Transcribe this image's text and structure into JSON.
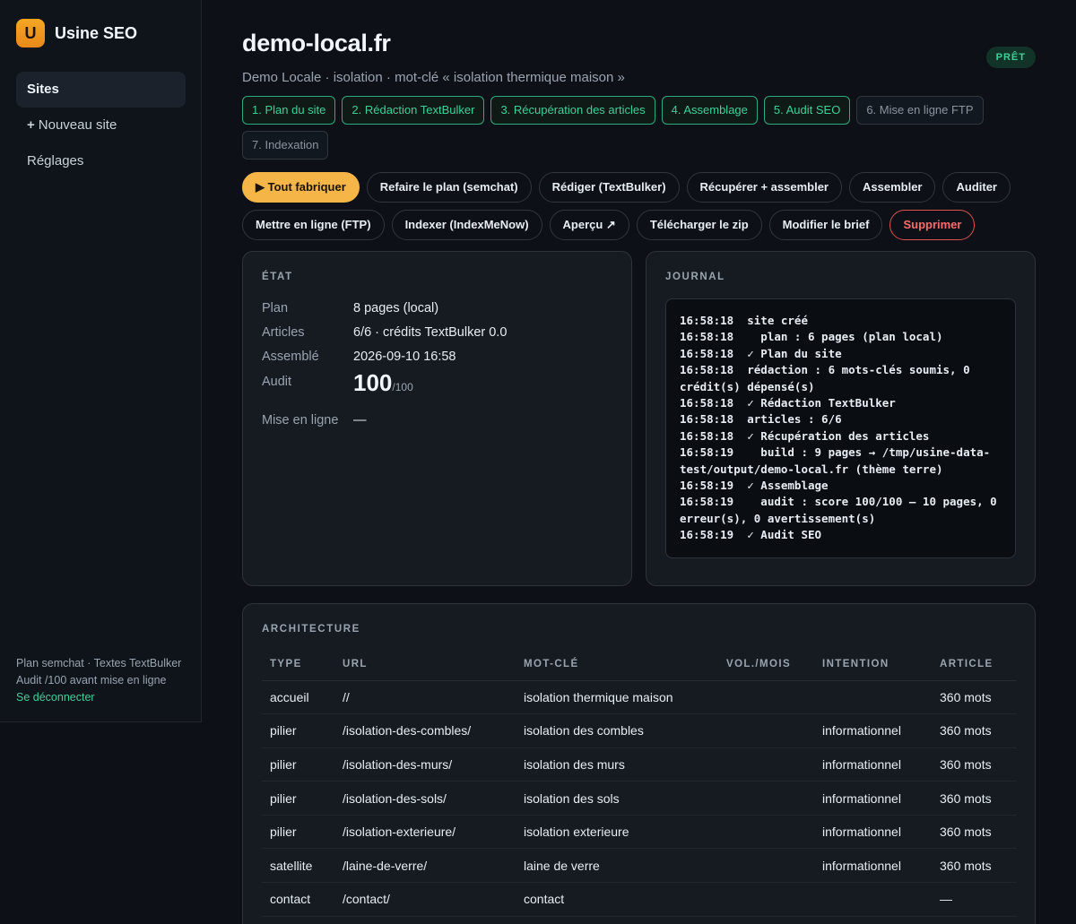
{
  "brand": {
    "logo_letter": "U",
    "name": "Usine SEO"
  },
  "sidebar": {
    "items": [
      {
        "label": "Sites"
      },
      {
        "icon": "+",
        "label": "Nouveau site"
      },
      {
        "label": "Réglages"
      }
    ],
    "footer": {
      "line1": "Plan semchat · Textes TextBulker",
      "line2": "Audit /100 avant mise en ligne",
      "logout": "Se déconnecter"
    }
  },
  "site": {
    "title": "demo-local.fr",
    "status": "PRÊT",
    "subtitle": "Demo Locale · isolation · mot-clé « isolation thermique maison »"
  },
  "steps": [
    {
      "label": "1. Plan du site",
      "done": true
    },
    {
      "label": "2. Rédaction TextBulker",
      "done": true
    },
    {
      "label": "3. Récupération des articles",
      "done": true
    },
    {
      "label": "4. Assemblage",
      "done": true
    },
    {
      "label": "5. Audit SEO",
      "done": true
    },
    {
      "label": "6. Mise en ligne FTP",
      "done": false
    },
    {
      "label": "7. Indexation",
      "done": false
    }
  ],
  "actions": [
    {
      "label": "▶ Tout fabriquer",
      "kind": "primary"
    },
    {
      "label": "Refaire le plan (semchat)",
      "kind": "default"
    },
    {
      "label": "Rédiger (TextBulker)",
      "kind": "default"
    },
    {
      "label": "Récupérer + assembler",
      "kind": "default"
    },
    {
      "label": "Assembler",
      "kind": "default"
    },
    {
      "label": "Auditer",
      "kind": "default"
    },
    {
      "label": "Mettre en ligne (FTP)",
      "kind": "default"
    },
    {
      "label": "Indexer (IndexMeNow)",
      "kind": "default"
    },
    {
      "label": "Aperçu ↗",
      "kind": "default"
    },
    {
      "label": "Télécharger le zip",
      "kind": "default"
    },
    {
      "label": "Modifier le brief",
      "kind": "default"
    },
    {
      "label": "Supprimer",
      "kind": "danger"
    }
  ],
  "etat": {
    "title": "ÉTAT",
    "plan_label": "Plan",
    "plan_value": "8 pages (local)",
    "articles_label": "Articles",
    "articles_value": "6/6 · crédits TextBulker 0.0",
    "assemble_label": "Assemblé",
    "assemble_value": "2026-09-10 16:58",
    "audit_label": "Audit",
    "audit_score": "100",
    "audit_den": "/100",
    "online_label": "Mise en ligne",
    "online_value": "—"
  },
  "journal": {
    "title": "JOURNAL",
    "lines": [
      "16:58:18  site créé",
      "16:58:18    plan : 6 pages (plan local)",
      "16:58:18  ✓ Plan du site",
      "16:58:18  rédaction : 6 mots-clés soumis, 0 crédit(s) dépensé(s)",
      "16:58:18  ✓ Rédaction TextBulker",
      "16:58:18  articles : 6/6",
      "16:58:18  ✓ Récupération des articles",
      "16:58:19    build : 9 pages → /tmp/usine-data-test/output/demo-local.fr (thème terre)",
      "16:58:19  ✓ Assemblage",
      "16:58:19    audit : score 100/100 — 10 pages, 0 erreur(s), 0 avertissement(s)",
      "16:58:19  ✓ Audit SEO"
    ]
  },
  "architecture": {
    "title": "ARCHITECTURE",
    "columns": [
      "TYPE",
      "URL",
      "MOT-CLÉ",
      "VOL./MOIS",
      "INTENTION",
      "ARTICLE"
    ],
    "rows": [
      [
        "accueil",
        "//",
        "isolation thermique maison",
        "",
        "",
        "360 mots"
      ],
      [
        "pilier",
        "/isolation-des-combles/",
        "isolation des combles",
        "",
        "informationnel",
        "360 mots"
      ],
      [
        "pilier",
        "/isolation-des-murs/",
        "isolation des murs",
        "",
        "informationnel",
        "360 mots"
      ],
      [
        "pilier",
        "/isolation-des-sols/",
        "isolation des sols",
        "",
        "informationnel",
        "360 mots"
      ],
      [
        "pilier",
        "/isolation-exterieure/",
        "isolation exterieure",
        "",
        "informationnel",
        "360 mots"
      ],
      [
        "satellite",
        "/laine-de-verre/",
        "laine de verre",
        "",
        "informationnel",
        "360 mots"
      ],
      [
        "contact",
        "/contact/",
        "contact",
        "",
        "",
        "—"
      ],
      [
        "",
        "",
        "",
        "",
        "",
        ""
      ]
    ]
  }
}
